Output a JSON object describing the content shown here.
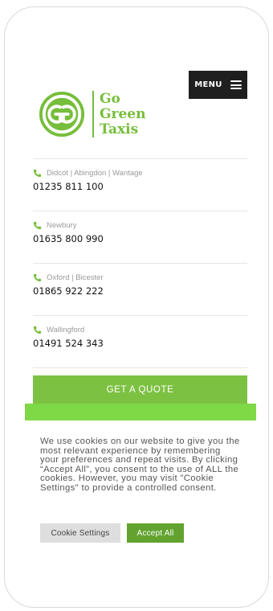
{
  "header": {
    "menu_label": "MENU",
    "logo": {
      "line1": "Go",
      "line2": "Green",
      "line3": "Taxis",
      "color": "#76be3b"
    }
  },
  "contacts": [
    {
      "region": "Didcot | Abingdon | Wantage",
      "phone": "01235 811 100"
    },
    {
      "region": "Newbury",
      "phone": "01635 800 990"
    },
    {
      "region": "Oxford | Bicester",
      "phone": "01865 922 222"
    },
    {
      "region": "Wallingford",
      "phone": "01491 524 343"
    }
  ],
  "cta": {
    "quote_label": "GET A QUOTE",
    "color": "#7dc142"
  },
  "cookie": {
    "text": "We use cookies on our website to give you the most relevant experience by remembering your preferences and repeat visits. By clicking “Accept All”, you consent to the use of ALL the cookies. However, you may visit \"Cookie Settings\" to provide a controlled consent.",
    "settings_label": "Cookie Settings",
    "accept_label": "Accept All"
  },
  "icons": {
    "phone": "phone-icon",
    "menu": "hamburger-icon",
    "logo": "go-green-logo-icon"
  }
}
